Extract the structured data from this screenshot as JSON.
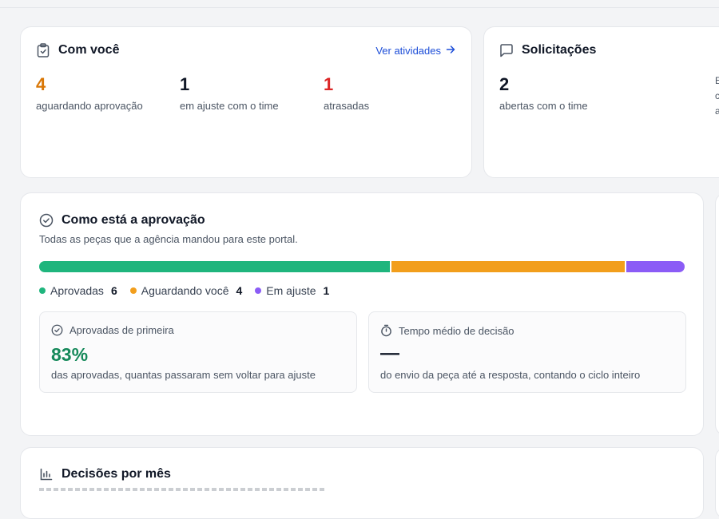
{
  "com_voce": {
    "title": "Com você",
    "link_label": "Ver atividades",
    "stats": [
      {
        "value": "4",
        "label": "aguardando aprovação",
        "color": "#d97706"
      },
      {
        "value": "1",
        "label": "em ajuste com o time",
        "color": "#111827"
      },
      {
        "value": "1",
        "label": "atrasadas",
        "color": "#dc2626"
      }
    ]
  },
  "solicitacoes": {
    "title": "Solicitações",
    "stat": {
      "value": "2",
      "label": "abertas com o time"
    },
    "cut_text": [
      "E",
      "c",
      "a"
    ]
  },
  "aprovacao": {
    "title": "Como está a aprovação",
    "subtitle": "Todas as peças que a agência mandou para este portal.",
    "segments": [
      {
        "label": "Aprovadas",
        "count": 6,
        "color": "#1fb57d"
      },
      {
        "label": "Aguardando você",
        "count": 4,
        "color": "#f29e1c"
      },
      {
        "label": "Em ajuste",
        "count": 1,
        "color": "#8b5cf6"
      }
    ],
    "first_pass": {
      "title": "Aprovadas de primeira",
      "value": "83%",
      "value_color": "#15895a",
      "desc": "das aprovadas, quantas passaram sem voltar para ajuste"
    },
    "avg_time": {
      "title": "Tempo médio de decisão",
      "value": "—",
      "desc": "do envio da peça até a resposta, contando o ciclo inteiro"
    }
  },
  "decisoes": {
    "title": "Decisões por mês"
  }
}
